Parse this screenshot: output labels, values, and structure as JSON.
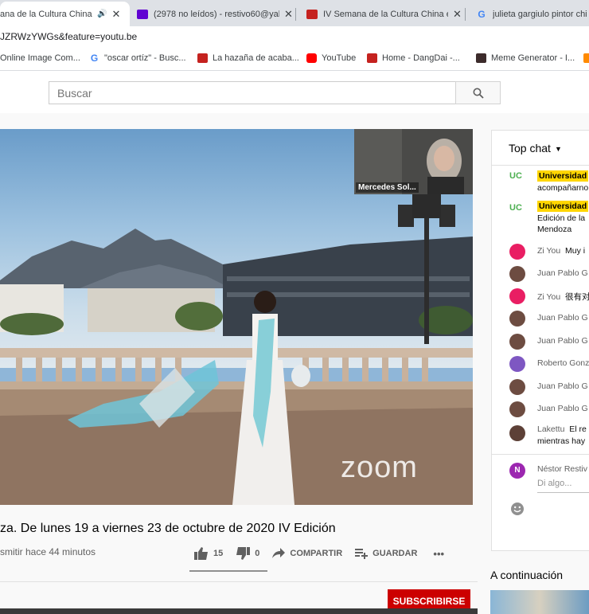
{
  "browser": {
    "tabs": [
      {
        "title": "ana de la Cultura China -",
        "audio": "🔊",
        "close": "✕",
        "active": true
      },
      {
        "title": "(2978 no leídos) - restivo60@yah",
        "close": "✕",
        "active": false
      },
      {
        "title": "IV Semana de la Cultura China en",
        "close": "✕",
        "active": false
      },
      {
        "title": "julieta gargiulo pintor chi",
        "active": false
      }
    ],
    "url": "JZRWzYWGs&feature=youtu.be",
    "bookmarks": [
      {
        "label": "Online Image Com..."
      },
      {
        "label": "\"oscar ortíz\" - Busc..."
      },
      {
        "label": "La hazaña de acaba..."
      },
      {
        "label": "YouTube"
      },
      {
        "label": "Home - DangDai -..."
      },
      {
        "label": "Meme Generator - I..."
      }
    ]
  },
  "header": {
    "search_placeholder": "Buscar"
  },
  "video": {
    "pip_name": "Mercedes Sol...",
    "watermark": "zoom",
    "title": "za. De lunes 19 a viernes 23 de octubre de 2020 IV Edición",
    "info": "smitir hace 44 minutos",
    "likes": "15",
    "dislikes": "0",
    "share_label": "COMPARTIR",
    "save_label": "GUARDAR",
    "more_label": "•••",
    "subscribe_label": "SUBSCRIBIRSE"
  },
  "chat": {
    "header": "Top chat",
    "messages": [
      {
        "logo": "UC",
        "badge": "Universidad",
        "line1": "acompañarno"
      },
      {
        "logo": "UC",
        "badge": "Universidad",
        "line1": "Edición de la",
        "line2": "Mendoza"
      },
      {
        "author": "Zi You",
        "text": "Muy i",
        "color": "#e91e63"
      },
      {
        "author": "Juan Pablo G",
        "text": "",
        "color": "#6d4c41"
      },
      {
        "author": "Zi You",
        "text": "很有对",
        "color": "#e91e63"
      },
      {
        "author": "Juan Pablo G",
        "text": "",
        "color": "#6d4c41"
      },
      {
        "author": "Juan Pablo G",
        "text": "",
        "color": "#6d4c41"
      },
      {
        "author": "Roberto Gonz",
        "text": "",
        "color": "#7e57c2"
      },
      {
        "author": "Juan Pablo G",
        "text": "",
        "color": "#6d4c41"
      },
      {
        "author": "Juan Pablo G",
        "text": "",
        "color": "#6d4c41"
      },
      {
        "author": "Lakettu",
        "text": "El re",
        "line2": "mientras hay",
        "color": "#5d4037"
      }
    ],
    "input_user": "Néstor Restiv",
    "input_user_initial": "N",
    "input_placeholder": "Di algo..."
  },
  "sidebar": {
    "up_next_label": "A continuación"
  },
  "colors": {
    "subscribe": "#cc0000",
    "badge": "#ffd600",
    "uc_green": "#4caf50"
  }
}
